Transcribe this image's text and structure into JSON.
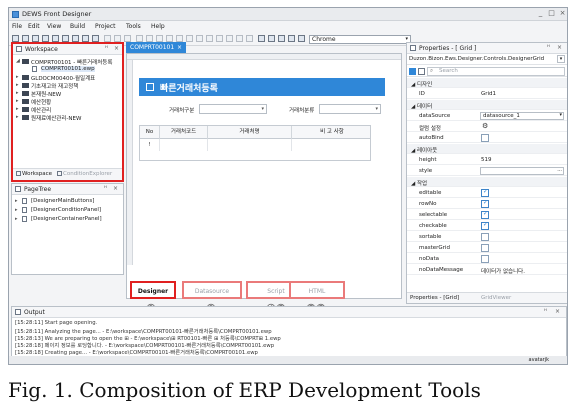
{
  "window": {
    "title": "DEWS Front Designer",
    "controls": [
      "_",
      "□",
      "×"
    ]
  },
  "menu": [
    "File",
    "Edit",
    "View",
    "Build",
    "Project",
    "Tools",
    "Help"
  ],
  "toolbar": {
    "combo_value": "Chrome",
    "combo_arrow": "▾"
  },
  "workspace": {
    "title": "Workspace",
    "controls": [
      "ᵸ",
      "×"
    ],
    "tree": [
      {
        "arrow": "◢",
        "label": "COMPRT00101 - 빠른거래처등록",
        "kind": "folder"
      },
      {
        "arrow": "",
        "label": "COMPRT00101.ewp",
        "kind": "file",
        "selected": true
      },
      {
        "arrow": "▸",
        "label": "GLDOCM00400-월일계표",
        "kind": "folder"
      },
      {
        "arrow": "▸",
        "label": "기초재고와 재고정책",
        "kind": "folder"
      },
      {
        "arrow": "▸",
        "label": "본재원-NEW",
        "kind": "folder"
      },
      {
        "arrow": "▸",
        "label": "예산현황",
        "kind": "folder"
      },
      {
        "arrow": "▸",
        "label": "예산관리",
        "kind": "folder"
      },
      {
        "arrow": "▸",
        "label": "원재료예산관리-NEW",
        "kind": "folder"
      }
    ],
    "tabs": [
      "Workspace",
      "ConditionExplorer"
    ]
  },
  "pagetree": {
    "title": "PageTree",
    "controls": [
      "ᵸ",
      "×"
    ],
    "items": [
      "[DesignerMainButtons]",
      "[DesignerConditionPanel]",
      "[DesignerContainerPanel]"
    ]
  },
  "doc_tab": {
    "label": "COMPRT00101",
    "close": "×"
  },
  "form": {
    "title": "빠른거래처등록",
    "search": [
      {
        "label": "거래처구분",
        "arrow": "▾"
      },
      {
        "label": "거래처분류",
        "arrow": "▾"
      }
    ],
    "grid": {
      "columns": [
        "No",
        "거래처코드",
        "거래처명",
        "비 고 사항"
      ],
      "row_marker": "!"
    }
  },
  "editor_tabs": [
    {
      "label": "Designer",
      "active": true
    },
    {
      "label": "Datasource",
      "active": false
    },
    {
      "label": "Script",
      "active": false
    },
    {
      "label": "HTML",
      "active": false
    }
  ],
  "tab_numbers": [
    "②",
    "③",
    "④⑤",
    "⑤⑤"
  ],
  "properties": {
    "title": "Properties - [ Grid ]",
    "controls": [
      "ᵸ",
      "×"
    ],
    "path": "Duzon.Bizon.Ews.Designer.Controls.DesignerGrid",
    "path_arrow": "▾",
    "search_placeholder": "Search",
    "search_icon": "⌕",
    "rows": [
      {
        "type": "cat",
        "name": "◢ 디자인"
      },
      {
        "type": "text",
        "name": "ID",
        "value": "Grid1"
      },
      {
        "type": "cat",
        "name": "◢ 데이터"
      },
      {
        "type": "combo",
        "name": "dataSource",
        "value": "datasource_1",
        "arrow": "▾"
      },
      {
        "type": "gear",
        "name": "컬럼 설정",
        "value": "⚙"
      },
      {
        "type": "check",
        "name": "autoBind",
        "checked": false
      },
      {
        "type": "cat",
        "name": "◢ 레이아웃"
      },
      {
        "type": "text",
        "name": "height",
        "value": "519"
      },
      {
        "type": "combo",
        "name": "style",
        "value": "",
        "arrow": "..."
      },
      {
        "type": "cat",
        "name": "◢ 작업"
      },
      {
        "type": "check",
        "name": "editable",
        "checked": true
      },
      {
        "type": "check",
        "name": "rowNo",
        "checked": true
      },
      {
        "type": "check",
        "name": "selectable",
        "checked": true
      },
      {
        "type": "check",
        "name": "checkable",
        "checked": true
      },
      {
        "type": "check",
        "name": "sortable",
        "checked": false
      },
      {
        "type": "check",
        "name": "masterGrid",
        "checked": false
      },
      {
        "type": "check",
        "name": "noData",
        "checked": false
      },
      {
        "type": "text",
        "name": "noDataMessage",
        "value": "데이터가 없습니다."
      }
    ],
    "tabs": [
      "Properties - [Grid]",
      "GridViewer"
    ]
  },
  "output": {
    "title": "Output",
    "controls": [
      "ᵸ",
      "×"
    ],
    "lines": [
      "[15:28:11]  Start page opening.",
      "[15:28:11]  Analyzing the page... - E:\\workspace\\COMPRT00101-빠른거래처등록\\COMPRT00101.ewp",
      "[15:28:13]  We are preparing to open the ⊞ - E:\\workspace\\⊞ RT00101-빠른 ⊞ 처등록\\COMPRT⊞ 1.ewp",
      "[15:28:18]  페이지 정보를 로딩합니다. - E:\\workspace\\COMPRT00101-빠른거래처등록\\COMPRT00101.ewp",
      "[15:28:18]  Creating page... - E:\\workspace\\COMPRT00101-빠른거래처등록\\COMPRT00101.ewp"
    ]
  },
  "status": {
    "user": "avatarjk"
  },
  "caption": "Fig. 1. Composition of ERP Development Tools",
  "colors": {
    "accent": "#2f87d8",
    "highlight_border": "#e02020"
  }
}
